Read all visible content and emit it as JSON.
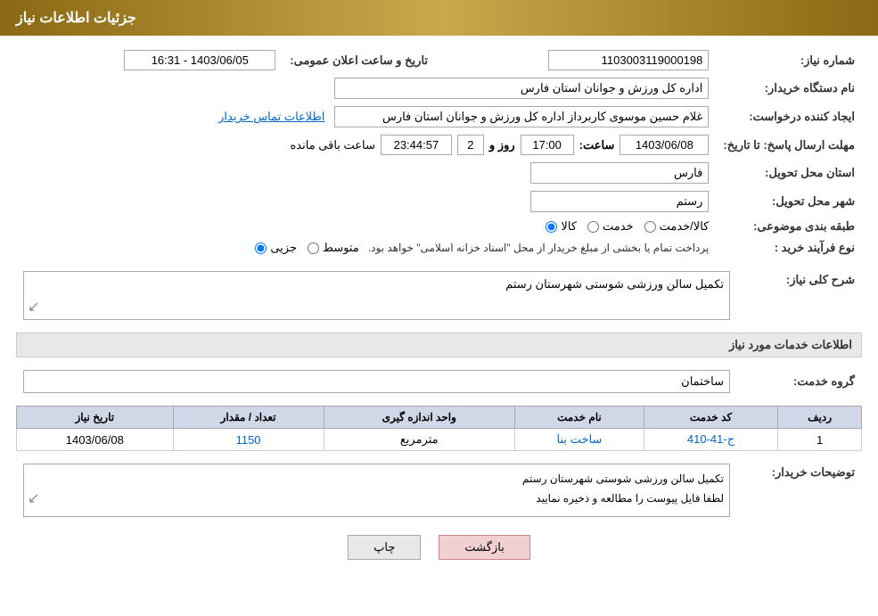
{
  "header": {
    "title": "جزئیات اطلاعات نیاز"
  },
  "fields": {
    "need_number_label": "شماره نیاز:",
    "need_number_value": "1103003119000198",
    "announce_datetime_label": "تاریخ و ساعت اعلان عمومی:",
    "announce_datetime_value": "1403/06/05 - 16:31",
    "buyer_org_label": "نام دستگاه خریدار:",
    "buyer_org_value": "اداره کل ورزش و جوانان استان فارس",
    "requester_label": "ایجاد کننده درخواست:",
    "requester_value": "غلام حسین موسوی کاربرداز اداره کل ورزش و جوانان استان فارس",
    "contact_link": "اطلاعات تماس خریدار",
    "deadline_label": "مهلت ارسال پاسخ: تا تاریخ:",
    "deadline_date": "1403/06/08",
    "deadline_time_label": "ساعت:",
    "deadline_time": "17:00",
    "deadline_days_label": "روز و",
    "deadline_days": "2",
    "remaining_label": "ساعت باقی مانده",
    "remaining_time": "23:44:57",
    "province_label": "استان محل تحویل:",
    "province_value": "فارس",
    "city_label": "شهر محل تحویل:",
    "city_value": "رستم",
    "category_label": "طبقه بندی موضوعی:",
    "category_options": [
      "کالا",
      "خدمت",
      "کالا/خدمت"
    ],
    "category_selected": "کالا",
    "process_label": "نوع فرآیند خرید :",
    "process_options": [
      "جزیی",
      "متوسط"
    ],
    "process_selected": "جزیی",
    "process_description": "پرداخت تمام یا بخشی از مبلغ خریدار از محل \"اسناد خزانه اسلامی\" خواهد بود.",
    "need_description_label": "شرح کلی نیاز:",
    "need_description_value": "تکمیل سالن ورزشی شوستی شهرستان رستم",
    "services_section_label": "اطلاعات خدمات مورد نیاز",
    "service_group_label": "گروه خدمت:",
    "service_group_value": "ساختمان",
    "table": {
      "headers": [
        "ردیف",
        "کد خدمت",
        "نام خدمت",
        "واحد اندازه گیری",
        "تعداد / مقدار",
        "تاریخ نیاز"
      ],
      "rows": [
        {
          "row": "1",
          "code": "ج-41-410",
          "name": "ساخت بنا",
          "unit": "مترمربع",
          "quantity": "1150",
          "date": "1403/06/08"
        }
      ]
    },
    "buyer_notes_label": "توضیحات خریدار:",
    "buyer_notes_line1": "تکمیل سالن ورزشی شوستی شهرستان رستم",
    "buyer_notes_line2": "لطفا فایل پیوست را مطالعه و ذخیره نمایید",
    "btn_print": "چاپ",
    "btn_back": "بازگشت"
  }
}
